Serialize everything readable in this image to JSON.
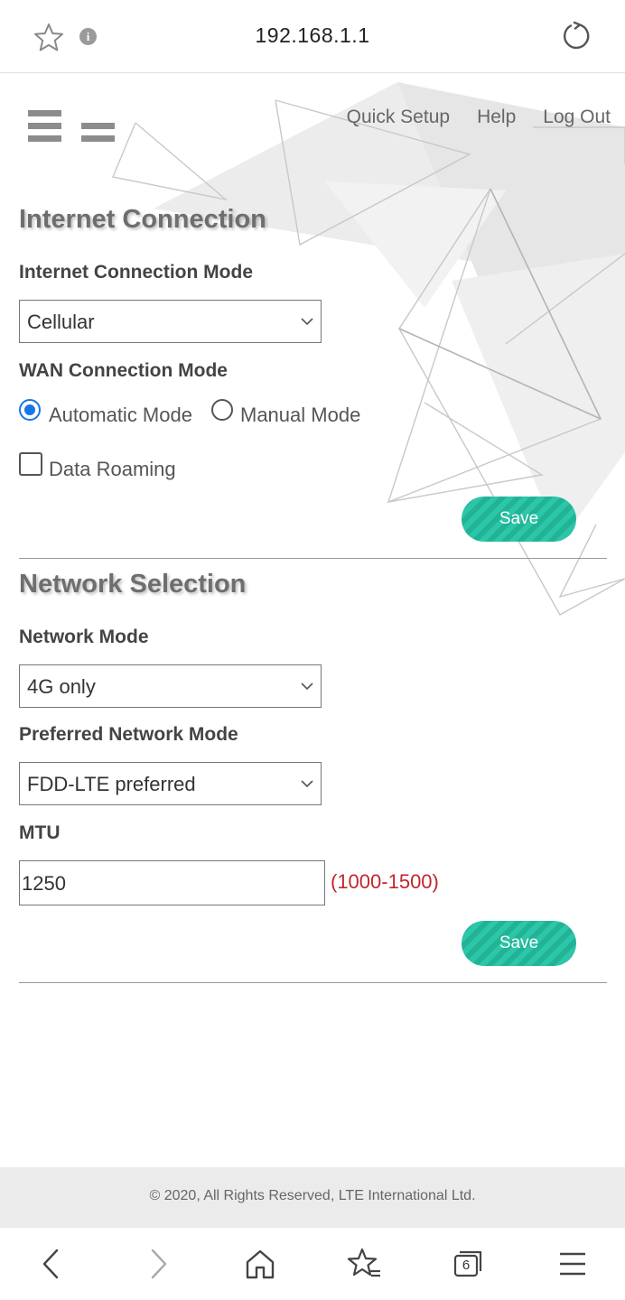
{
  "browser": {
    "url": "192.168.1.1",
    "tab_count": "6"
  },
  "nav": {
    "quick_setup": "Quick Setup",
    "help": "Help",
    "log_out": "Log Out"
  },
  "internet_connection": {
    "title": "Internet Connection",
    "mode_label": "Internet Connection Mode",
    "mode_value": "Cellular",
    "wan_label": "WAN Connection Mode",
    "wan_options": [
      {
        "label": "Automatic Mode",
        "selected": true
      },
      {
        "label": "Manual Mode",
        "selected": false
      }
    ],
    "data_roaming_label": "Data Roaming",
    "data_roaming_checked": false,
    "save_label": "Save"
  },
  "network_selection": {
    "title": "Network Selection",
    "network_mode_label": "Network Mode",
    "network_mode_value": "4G only",
    "preferred_label": "Preferred Network Mode",
    "preferred_value": "FDD-LTE preferred",
    "mtu_label": "MTU",
    "mtu_value": "1250",
    "mtu_range": "(1000-1500)",
    "save_label": "Save"
  },
  "footer": {
    "copyright": "© 2020, All Rights Reserved, LTE International Ltd."
  },
  "colors": {
    "accent": "#2cc6a8",
    "radio_selected": "#1a73e8",
    "range_text": "#c0262d"
  }
}
